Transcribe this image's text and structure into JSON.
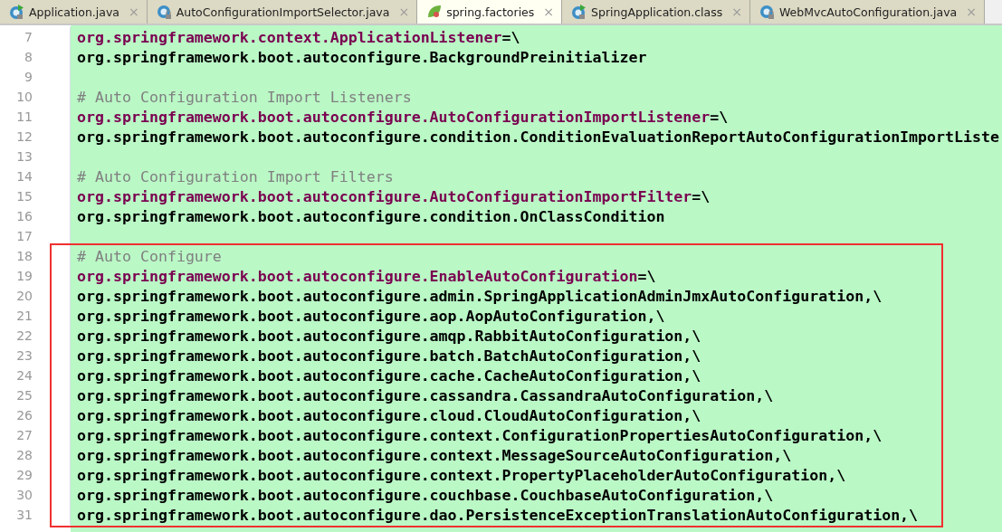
{
  "tabs": [
    {
      "label": "Application.java",
      "kind": "runnable-class",
      "selected": false,
      "close": "×"
    },
    {
      "label": "AutoConfigurationImportSelector.java",
      "kind": "locked-class",
      "selected": false,
      "close": "×"
    },
    {
      "label": "spring.factories",
      "kind": "spring-file",
      "selected": true,
      "close": "×"
    },
    {
      "label": "SpringApplication.class",
      "kind": "runnable-class",
      "selected": false,
      "close": "×"
    },
    {
      "label": "WebMvcAutoConfiguration.java",
      "kind": "locked-class",
      "selected": false,
      "close": "×"
    }
  ],
  "lines": [
    {
      "number": "7",
      "kind": "key",
      "text": "org.springframework.context.ApplicationListener",
      "operator": "=\\"
    },
    {
      "number": "8",
      "kind": "value",
      "text": "org.springframework.boot.autoconfigure.BackgroundPreinitializer"
    },
    {
      "number": "9",
      "kind": "blank"
    },
    {
      "number": "10",
      "kind": "comment",
      "text": "# Auto Configuration Import Listeners"
    },
    {
      "number": "11",
      "kind": "key",
      "text": "org.springframework.boot.autoconfigure.AutoConfigurationImportListener",
      "operator": "=\\"
    },
    {
      "number": "12",
      "kind": "value",
      "text": "org.springframework.boot.autoconfigure.condition.ConditionEvaluationReportAutoConfigurationImportListe"
    },
    {
      "number": "13",
      "kind": "blank"
    },
    {
      "number": "14",
      "kind": "comment",
      "text": "# Auto Configuration Import Filters"
    },
    {
      "number": "15",
      "kind": "key",
      "text": "org.springframework.boot.autoconfigure.AutoConfigurationImportFilter",
      "operator": "=\\"
    },
    {
      "number": "16",
      "kind": "value",
      "text": "org.springframework.boot.autoconfigure.condition.OnClassCondition"
    },
    {
      "number": "17",
      "kind": "blank"
    }
  ],
  "highlighted_block": {
    "lines": [
      {
        "number": "18",
        "kind": "comment",
        "text": "# Auto Configure"
      },
      {
        "number": "19",
        "kind": "key",
        "text": "org.springframework.boot.autoconfigure.EnableAutoConfiguration",
        "operator": "=\\"
      },
      {
        "number": "20",
        "kind": "value",
        "text": "org.springframework.boot.autoconfigure.admin.SpringApplicationAdminJmxAutoConfiguration,\\"
      },
      {
        "number": "21",
        "kind": "value",
        "text": "org.springframework.boot.autoconfigure.aop.AopAutoConfiguration,\\"
      },
      {
        "number": "22",
        "kind": "value",
        "text": "org.springframework.boot.autoconfigure.amqp.RabbitAutoConfiguration,\\"
      },
      {
        "number": "23",
        "kind": "value",
        "text": "org.springframework.boot.autoconfigure.batch.BatchAutoConfiguration,\\"
      },
      {
        "number": "24",
        "kind": "value",
        "text": "org.springframework.boot.autoconfigure.cache.CacheAutoConfiguration,\\"
      },
      {
        "number": "25",
        "kind": "value",
        "text": "org.springframework.boot.autoconfigure.cassandra.CassandraAutoConfiguration,\\"
      },
      {
        "number": "26",
        "kind": "value",
        "text": "org.springframework.boot.autoconfigure.cloud.CloudAutoConfiguration,\\"
      },
      {
        "number": "27",
        "kind": "value",
        "text": "org.springframework.boot.autoconfigure.context.ConfigurationPropertiesAutoConfiguration,\\"
      },
      {
        "number": "28",
        "kind": "value",
        "text": "org.springframework.boot.autoconfigure.context.MessageSourceAutoConfiguration,\\"
      },
      {
        "number": "29",
        "kind": "value",
        "text": "org.springframework.boot.autoconfigure.context.PropertyPlaceholderAutoConfiguration,\\"
      },
      {
        "number": "30",
        "kind": "value",
        "text": "org.springframework.boot.autoconfigure.couchbase.CouchbaseAutoConfiguration,\\"
      },
      {
        "number": "31",
        "kind": "value",
        "text": "org.springframework.boot.autoconfigure.dao.PersistenceExceptionTranslationAutoConfiguration,\\"
      }
    ]
  }
}
